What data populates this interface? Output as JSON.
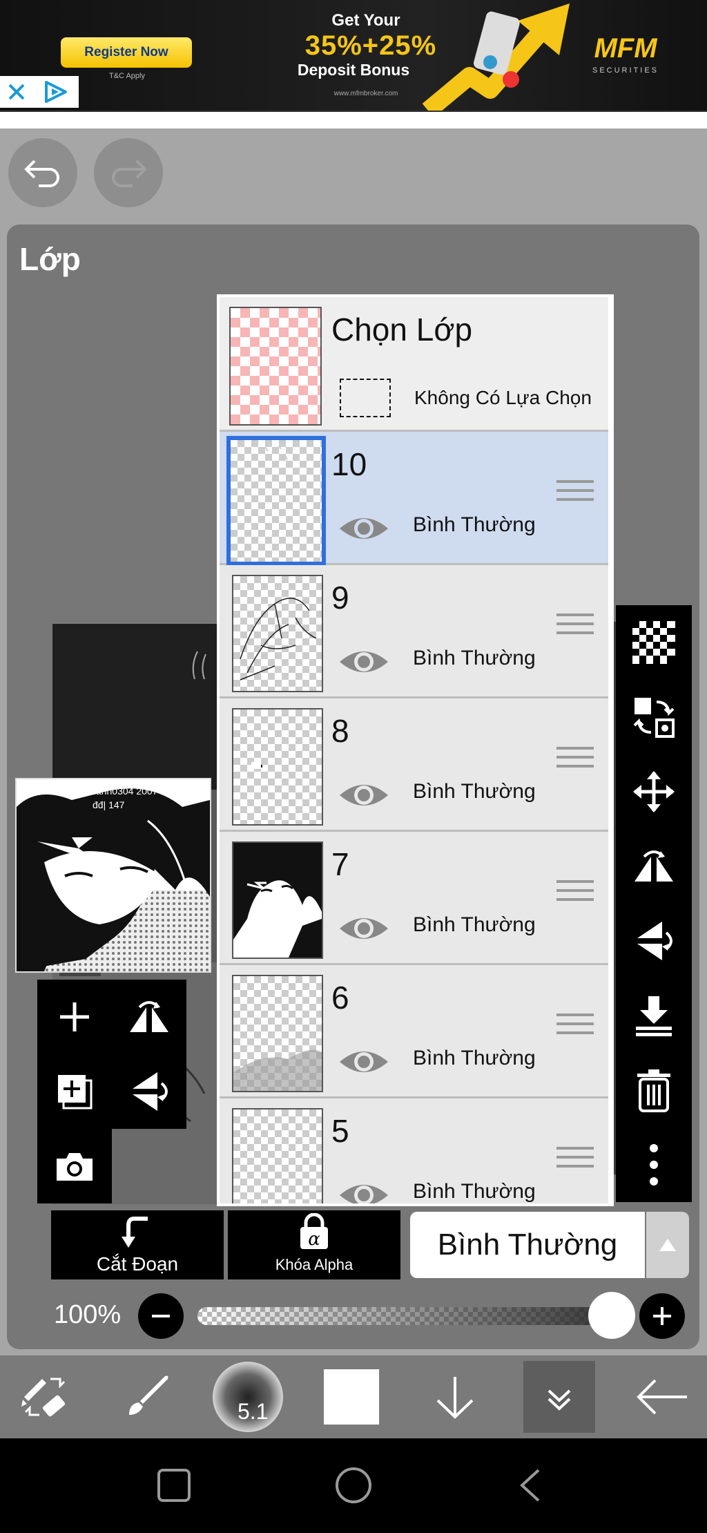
{
  "ad": {
    "register_label": "Register Now",
    "tc_label": "T&C Apply",
    "headline_top": "Get Your",
    "headline_pct": "35%+25%",
    "headline_bottom": "Deposit Bonus",
    "url": "www.mfmbroker.com",
    "brand": "MFM",
    "brand_sub": "SECURITIES"
  },
  "panel": {
    "title": "Lớp"
  },
  "selection_row": {
    "title": "Chọn Lớp",
    "subtitle": "Không Có Lựa Chọn"
  },
  "layers": [
    {
      "name": "10",
      "mode": "Bình Thường",
      "selected": true
    },
    {
      "name": "9",
      "mode": "Bình Thường",
      "selected": false
    },
    {
      "name": "8",
      "mode": "Bình Thường",
      "selected": false
    },
    {
      "name": "7",
      "mode": "Bình Thường",
      "selected": false
    },
    {
      "name": "6",
      "mode": "Bình Thường",
      "selected": false
    },
    {
      "name": "5",
      "mode": "Bình Thường",
      "selected": false
    }
  ],
  "bottom_controls": {
    "clip_label": "Cắt Đoạn",
    "alpha_label": "Khóa Alpha",
    "blend_mode": "Bình Thường",
    "opacity_label": "100%",
    "opacity_value": 1.0
  },
  "toolbar": {
    "brush_size_label": "5.1"
  },
  "thumbnail": {
    "signature_text": "Uhongthanh0304 2007",
    "signature_text2": "đđ| 147"
  },
  "colors": {
    "selected_row": "#cfdbef",
    "selected_border": "#2f6fdc",
    "ad_gold": "#f5c518"
  }
}
